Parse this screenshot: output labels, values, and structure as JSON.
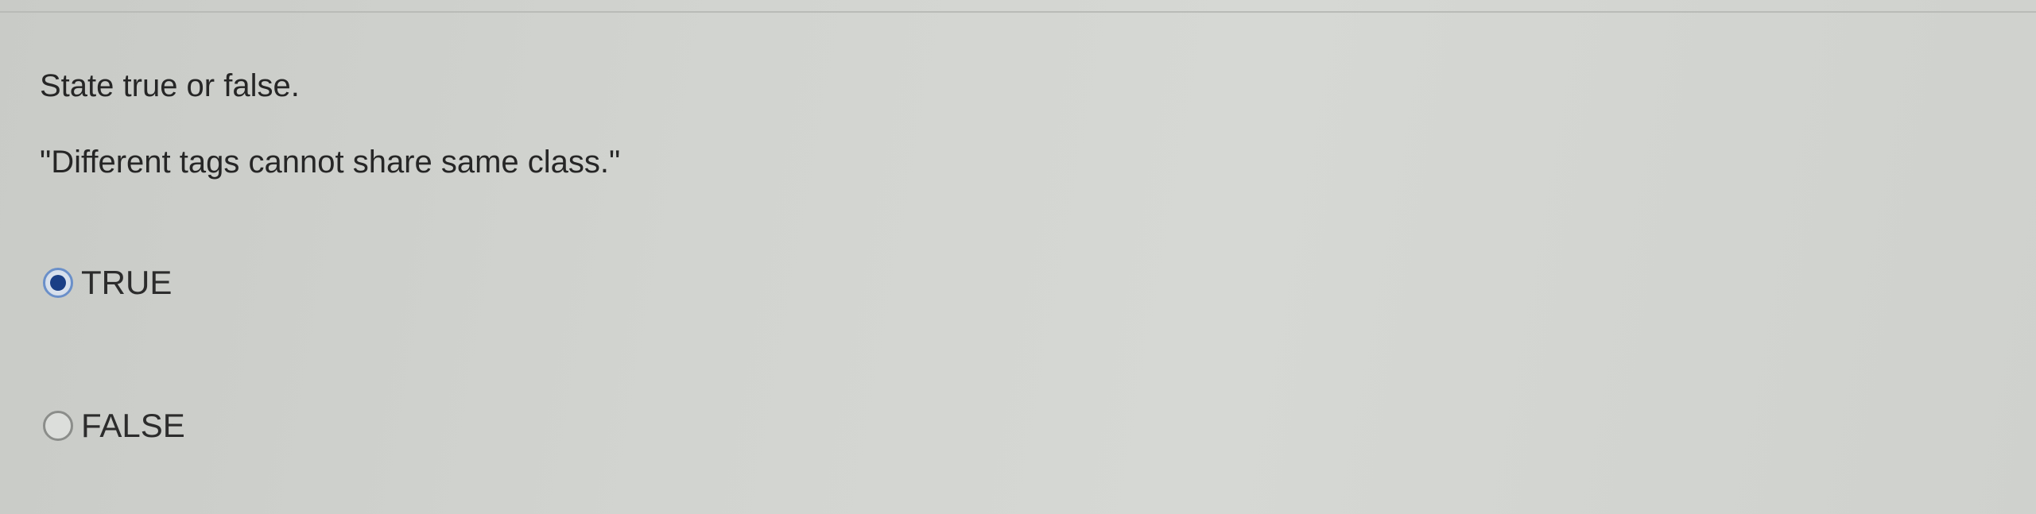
{
  "question": {
    "prompt": "State true or false.",
    "statement": "\"Different tags cannot share same class.\""
  },
  "options": [
    {
      "label": "TRUE",
      "selected": true
    },
    {
      "label": "FALSE",
      "selected": false
    }
  ],
  "colors": {
    "radio_selected_fill": "#1b3f86",
    "radio_selected_ring": "#6a8fc9",
    "radio_unselected_ring": "#8b8d8a",
    "background": "#d2d4d0"
  }
}
